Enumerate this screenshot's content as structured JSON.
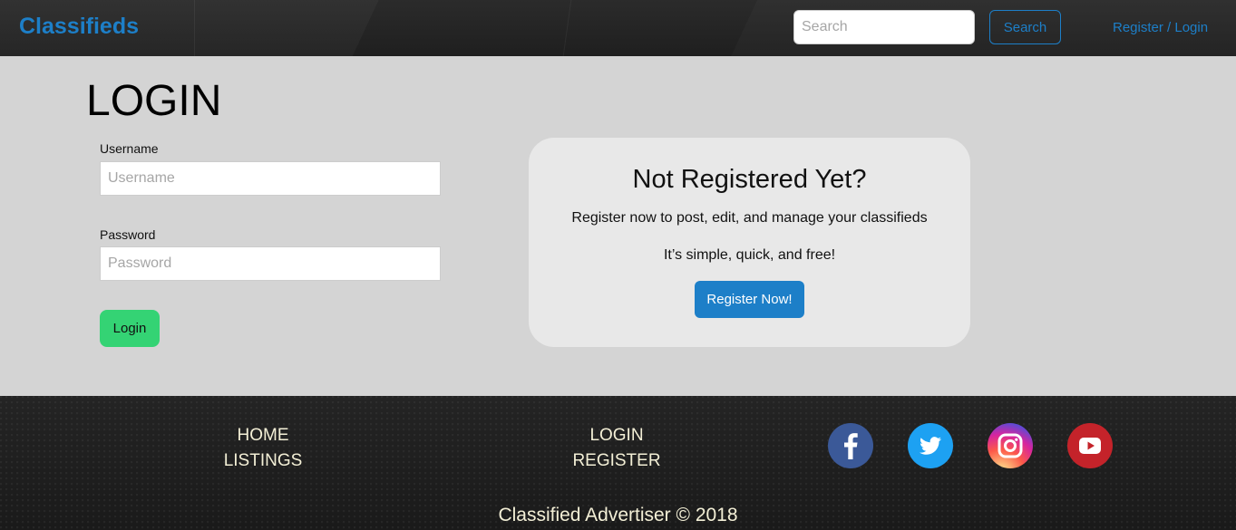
{
  "header": {
    "brand": "Classifieds",
    "search_placeholder": "Search",
    "search_button": "Search",
    "register_login_link": "Register / Login"
  },
  "login": {
    "title": "LOGIN",
    "username_label": "Username",
    "username_placeholder": "Username",
    "password_label": "Password",
    "password_placeholder": "Password",
    "login_button": "Login"
  },
  "promo": {
    "heading": "Not Registered Yet?",
    "line1": "Register now to post, edit, and manage your classifieds",
    "line2": "It’s simple, quick, and free!",
    "button": "Register Now!"
  },
  "footer": {
    "links": [
      "HOME",
      "LISTINGS",
      "LOGIN",
      "REGISTER"
    ],
    "social_icons": [
      "facebook-icon",
      "twitter-icon",
      "instagram-icon",
      "youtube-icon"
    ],
    "copyright": "Classified Advertiser © 2018"
  },
  "colors": {
    "brand_blue": "#1d7fc8",
    "login_green": "#34d374",
    "page_bg": "#d4d4d4",
    "promo_bg": "#e8e8e8",
    "footer_text": "#f3efd6"
  }
}
